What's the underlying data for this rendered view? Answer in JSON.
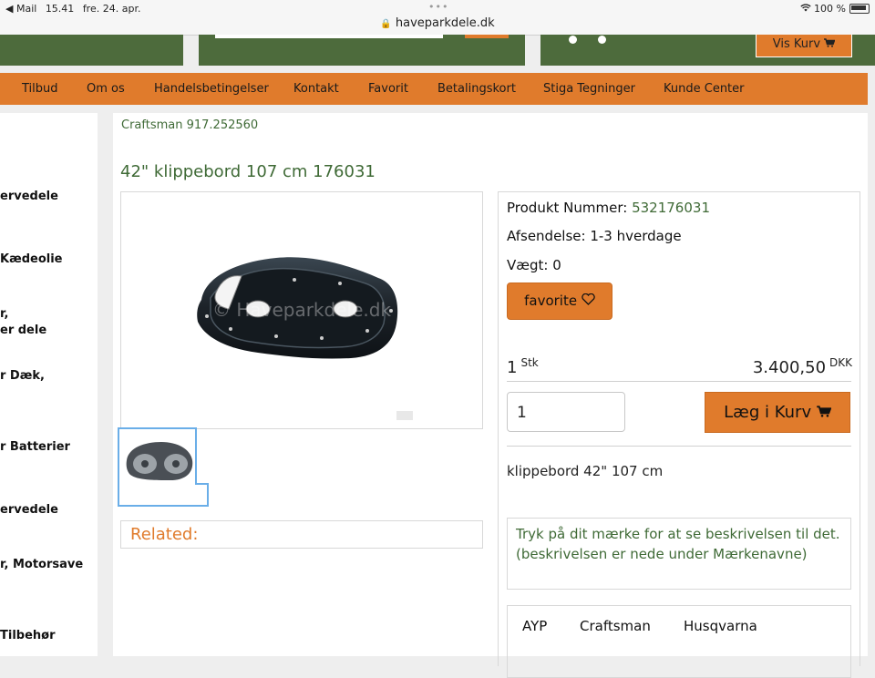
{
  "status_bar": {
    "back_app": "◀ Mail",
    "time": "15.41",
    "date": "fre. 24. apr.",
    "battery": "100 %",
    "url": "haveparkdele.dk"
  },
  "header": {
    "cart_button": "Vis Kurv"
  },
  "nav": [
    "Tilbud",
    "Om os",
    "Handelsbetingelser",
    "Kontakt",
    "Favorit",
    "Betalingskort",
    "Stiga Tegninger",
    "Kunde Center"
  ],
  "sidebar": {
    "items": [
      "ervedele",
      "Kædeolie",
      "r,",
      "er dele",
      "r Dæk,",
      "r Batterier",
      "ervedele",
      "r, Motorsave",
      "Tilbehør"
    ]
  },
  "product": {
    "breadcrumb": "Craftsman 917.252560",
    "title": "42\" klippebord 107 cm 176031",
    "watermark": "© Haveparkdele.dk",
    "related_label": "Related:",
    "number_label": "Produkt Nummer:",
    "number_value": "532176031",
    "shipping": "Afsendelse: 1-3 hverdage",
    "weight": "Vægt: 0",
    "favorite_label": "favorite",
    "qty_count": "1",
    "qty_unit": "Stk",
    "price": "3.400,50",
    "currency": "DKK",
    "qty_input_value": "1",
    "add_to_cart_label": "Læg i Kurv",
    "description": "klippebord 42\" 107 cm",
    "note": "Tryk på dit mærke for at se beskrivelsen til det. (beskrivelsen er nede under Mærkenavne)",
    "brands": [
      "AYP",
      "Craftsman",
      "Husqvarna"
    ]
  },
  "colors": {
    "header_green": "#4d6b3c",
    "accent_orange": "#e07b2c",
    "text_green": "#3f6a36"
  }
}
